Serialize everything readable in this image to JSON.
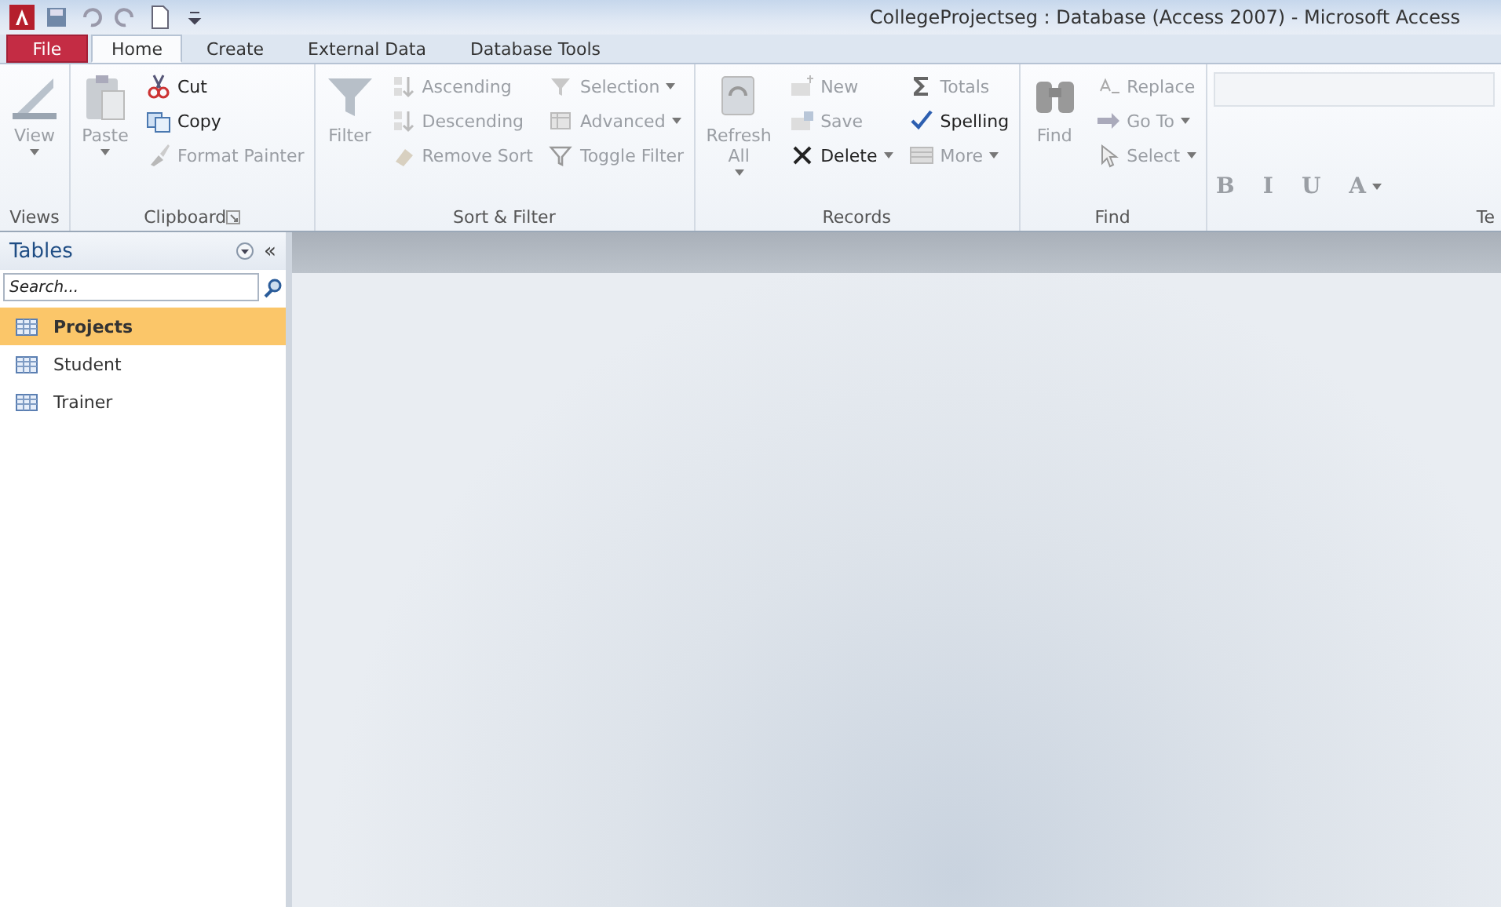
{
  "window": {
    "title": "CollegeProjectseg : Database (Access 2007)  -  Microsoft Access"
  },
  "tabs": [
    {
      "label": "File",
      "kind": "file",
      "selected": false
    },
    {
      "label": "Home",
      "kind": "tab",
      "selected": true
    },
    {
      "label": "Create",
      "kind": "tab",
      "selected": false
    },
    {
      "label": "External Data",
      "kind": "tab",
      "selected": false
    },
    {
      "label": "Database Tools",
      "kind": "tab",
      "selected": false
    }
  ],
  "ribbon_groups": [
    {
      "label": "Views",
      "dialog_launcher": false,
      "commands": [
        {
          "label": "View",
          "kind": "large",
          "disabled": true,
          "dropdown": true
        }
      ]
    },
    {
      "label": "Clipboard",
      "dialog_launcher": true,
      "commands": [
        {
          "label": "Paste",
          "kind": "large",
          "disabled": true,
          "dropdown": true
        },
        {
          "label": "Cut",
          "kind": "small",
          "disabled": false,
          "dropdown": false
        },
        {
          "label": "Copy",
          "kind": "small",
          "disabled": false,
          "dropdown": false
        },
        {
          "label": "Format Painter",
          "kind": "small",
          "disabled": true,
          "dropdown": false
        }
      ]
    },
    {
      "label": "Sort & Filter",
      "dialog_launcher": false,
      "commands": [
        {
          "label": "Filter",
          "kind": "large",
          "disabled": true,
          "dropdown": false
        },
        {
          "label": "Ascending",
          "kind": "small",
          "disabled": true,
          "dropdown": false
        },
        {
          "label": "Descending",
          "kind": "small",
          "disabled": true,
          "dropdown": false
        },
        {
          "label": "Remove Sort",
          "kind": "small",
          "disabled": true,
          "dropdown": false
        },
        {
          "label": "Selection",
          "kind": "small",
          "disabled": true,
          "dropdown": true
        },
        {
          "label": "Advanced",
          "kind": "small",
          "disabled": true,
          "dropdown": true
        },
        {
          "label": "Toggle Filter",
          "kind": "small",
          "disabled": true,
          "dropdown": false
        }
      ]
    },
    {
      "label": "Records",
      "dialog_launcher": false,
      "commands": [
        {
          "label": "Refresh All",
          "kind": "large",
          "disabled": true,
          "dropdown": true
        },
        {
          "label": "New",
          "kind": "small",
          "disabled": true,
          "dropdown": false
        },
        {
          "label": "Save",
          "kind": "small",
          "disabled": true,
          "dropdown": false
        },
        {
          "label": "Delete",
          "kind": "small",
          "disabled": false,
          "dropdown": true
        },
        {
          "label": "Totals",
          "kind": "small",
          "disabled": true,
          "dropdown": false
        },
        {
          "label": "Spelling",
          "kind": "small",
          "disabled": false,
          "dropdown": false
        },
        {
          "label": "More",
          "kind": "small",
          "disabled": true,
          "dropdown": true
        }
      ]
    },
    {
      "label": "Find",
      "dialog_launcher": false,
      "commands": [
        {
          "label": "Find",
          "kind": "large",
          "disabled": true,
          "dropdown": false
        },
        {
          "label": "Replace",
          "kind": "small",
          "disabled": true,
          "dropdown": false
        },
        {
          "label": "Go To",
          "kind": "small",
          "disabled": true,
          "dropdown": true
        },
        {
          "label": "Select",
          "kind": "small",
          "disabled": true,
          "dropdown": true
        }
      ]
    },
    {
      "label": "Te",
      "dialog_launcher": false,
      "commands": [
        {
          "label": "B",
          "kind": "format",
          "disabled": true,
          "dropdown": false
        },
        {
          "label": "I",
          "kind": "format",
          "disabled": true,
          "dropdown": false
        },
        {
          "label": "U",
          "kind": "format",
          "disabled": true,
          "dropdown": false
        },
        {
          "label": "A",
          "kind": "format",
          "disabled": true,
          "dropdown": true
        }
      ]
    }
  ],
  "nav_pane": {
    "title": "Tables",
    "collapse": "«",
    "search": {
      "placeholder": "Search..."
    },
    "items": [
      {
        "label": "Projects",
        "selected": true
      },
      {
        "label": "Student",
        "selected": false
      },
      {
        "label": "Trainer",
        "selected": false
      }
    ]
  }
}
